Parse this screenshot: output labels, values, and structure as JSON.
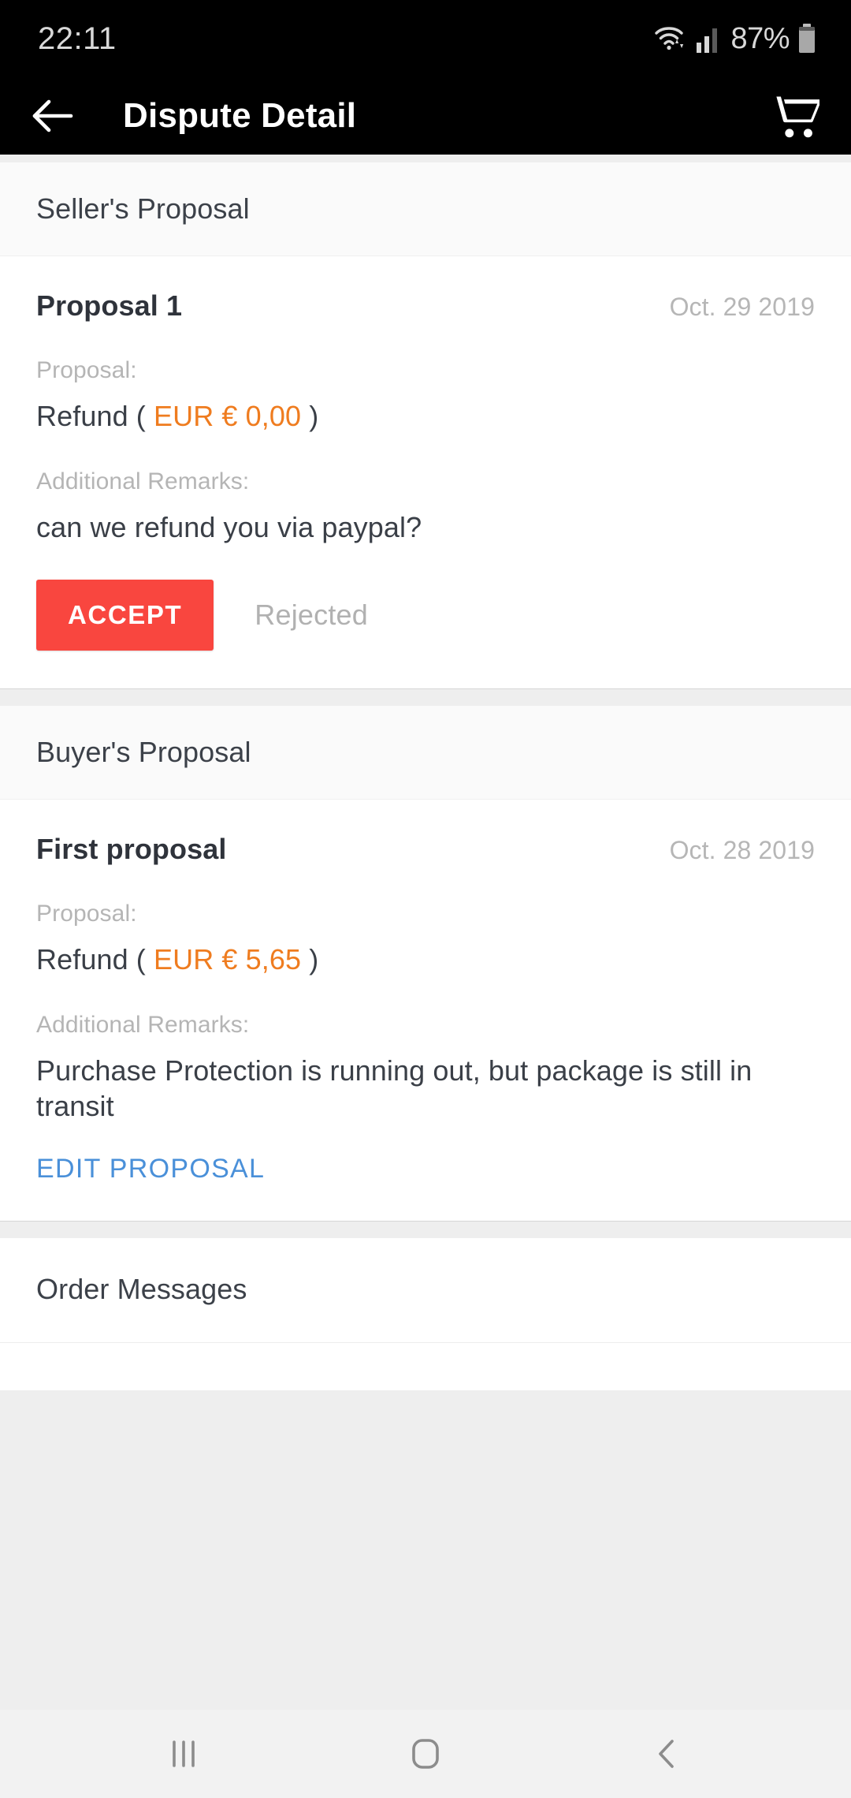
{
  "status_bar": {
    "time": "22:11",
    "battery_percent": "87%",
    "icons": [
      "wifi-icon",
      "cellular-signal-icon",
      "battery-icon"
    ]
  },
  "app_bar": {
    "back_icon": "back-arrow-icon",
    "title": "Dispute Detail",
    "cart_icon": "shopping-cart-icon"
  },
  "sections": {
    "seller": {
      "header": "Seller's Proposal",
      "proposal": {
        "title": "Proposal 1",
        "date": "Oct. 29 2019",
        "proposal_label": "Proposal:",
        "refund_prefix": "Refund (",
        "refund_amount": "EUR € 0,00",
        "refund_suffix": ")",
        "remarks_label": "Additional Remarks:",
        "remarks_text": "can we refund you via paypal?",
        "accept_label": "ACCEPT",
        "rejected_label": "Rejected"
      }
    },
    "buyer": {
      "header": "Buyer's Proposal",
      "proposal": {
        "title": "First proposal",
        "date": "Oct. 28 2019",
        "proposal_label": "Proposal:",
        "refund_prefix": "Refund (",
        "refund_amount": "EUR € 5,65",
        "refund_suffix": ")",
        "remarks_label": "Additional Remarks:",
        "remarks_text": "Purchase Protection is running out, but package is still in transit",
        "edit_label": "EDIT PROPOSAL"
      }
    },
    "messages": {
      "header": "Order Messages"
    }
  },
  "nav_bar": {
    "recents_icon": "recents-icon",
    "home_icon": "home-icon",
    "back_icon": "back-chevron-icon"
  },
  "colors": {
    "accent_red": "#f9463f",
    "amount_orange": "#ef7c1f",
    "link_blue": "#4a90d9",
    "app_bar_bg": "#000000",
    "page_bg": "#eeeeee"
  }
}
